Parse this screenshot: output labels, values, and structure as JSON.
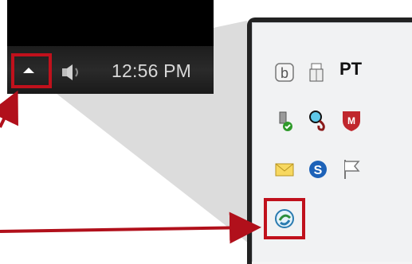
{
  "taskbar": {
    "clock": "12:56 PM",
    "show_hidden_icons_label": "Show hidden icons"
  },
  "tray_overflow": {
    "icons": [
      "bitdefender-icon",
      "usb-drive-icon",
      "pt-text-icon",
      "safely-remove-hardware-icon",
      "magnifier-q-icon",
      "mcafee-shield-icon",
      "mail-envelope-icon",
      "skype-icon",
      "action-center-flag-icon",
      "connection-circle-icon"
    ],
    "pt_text": "PT"
  },
  "colors": {
    "highlight": "#c0111c",
    "taskbar": "#000000"
  }
}
